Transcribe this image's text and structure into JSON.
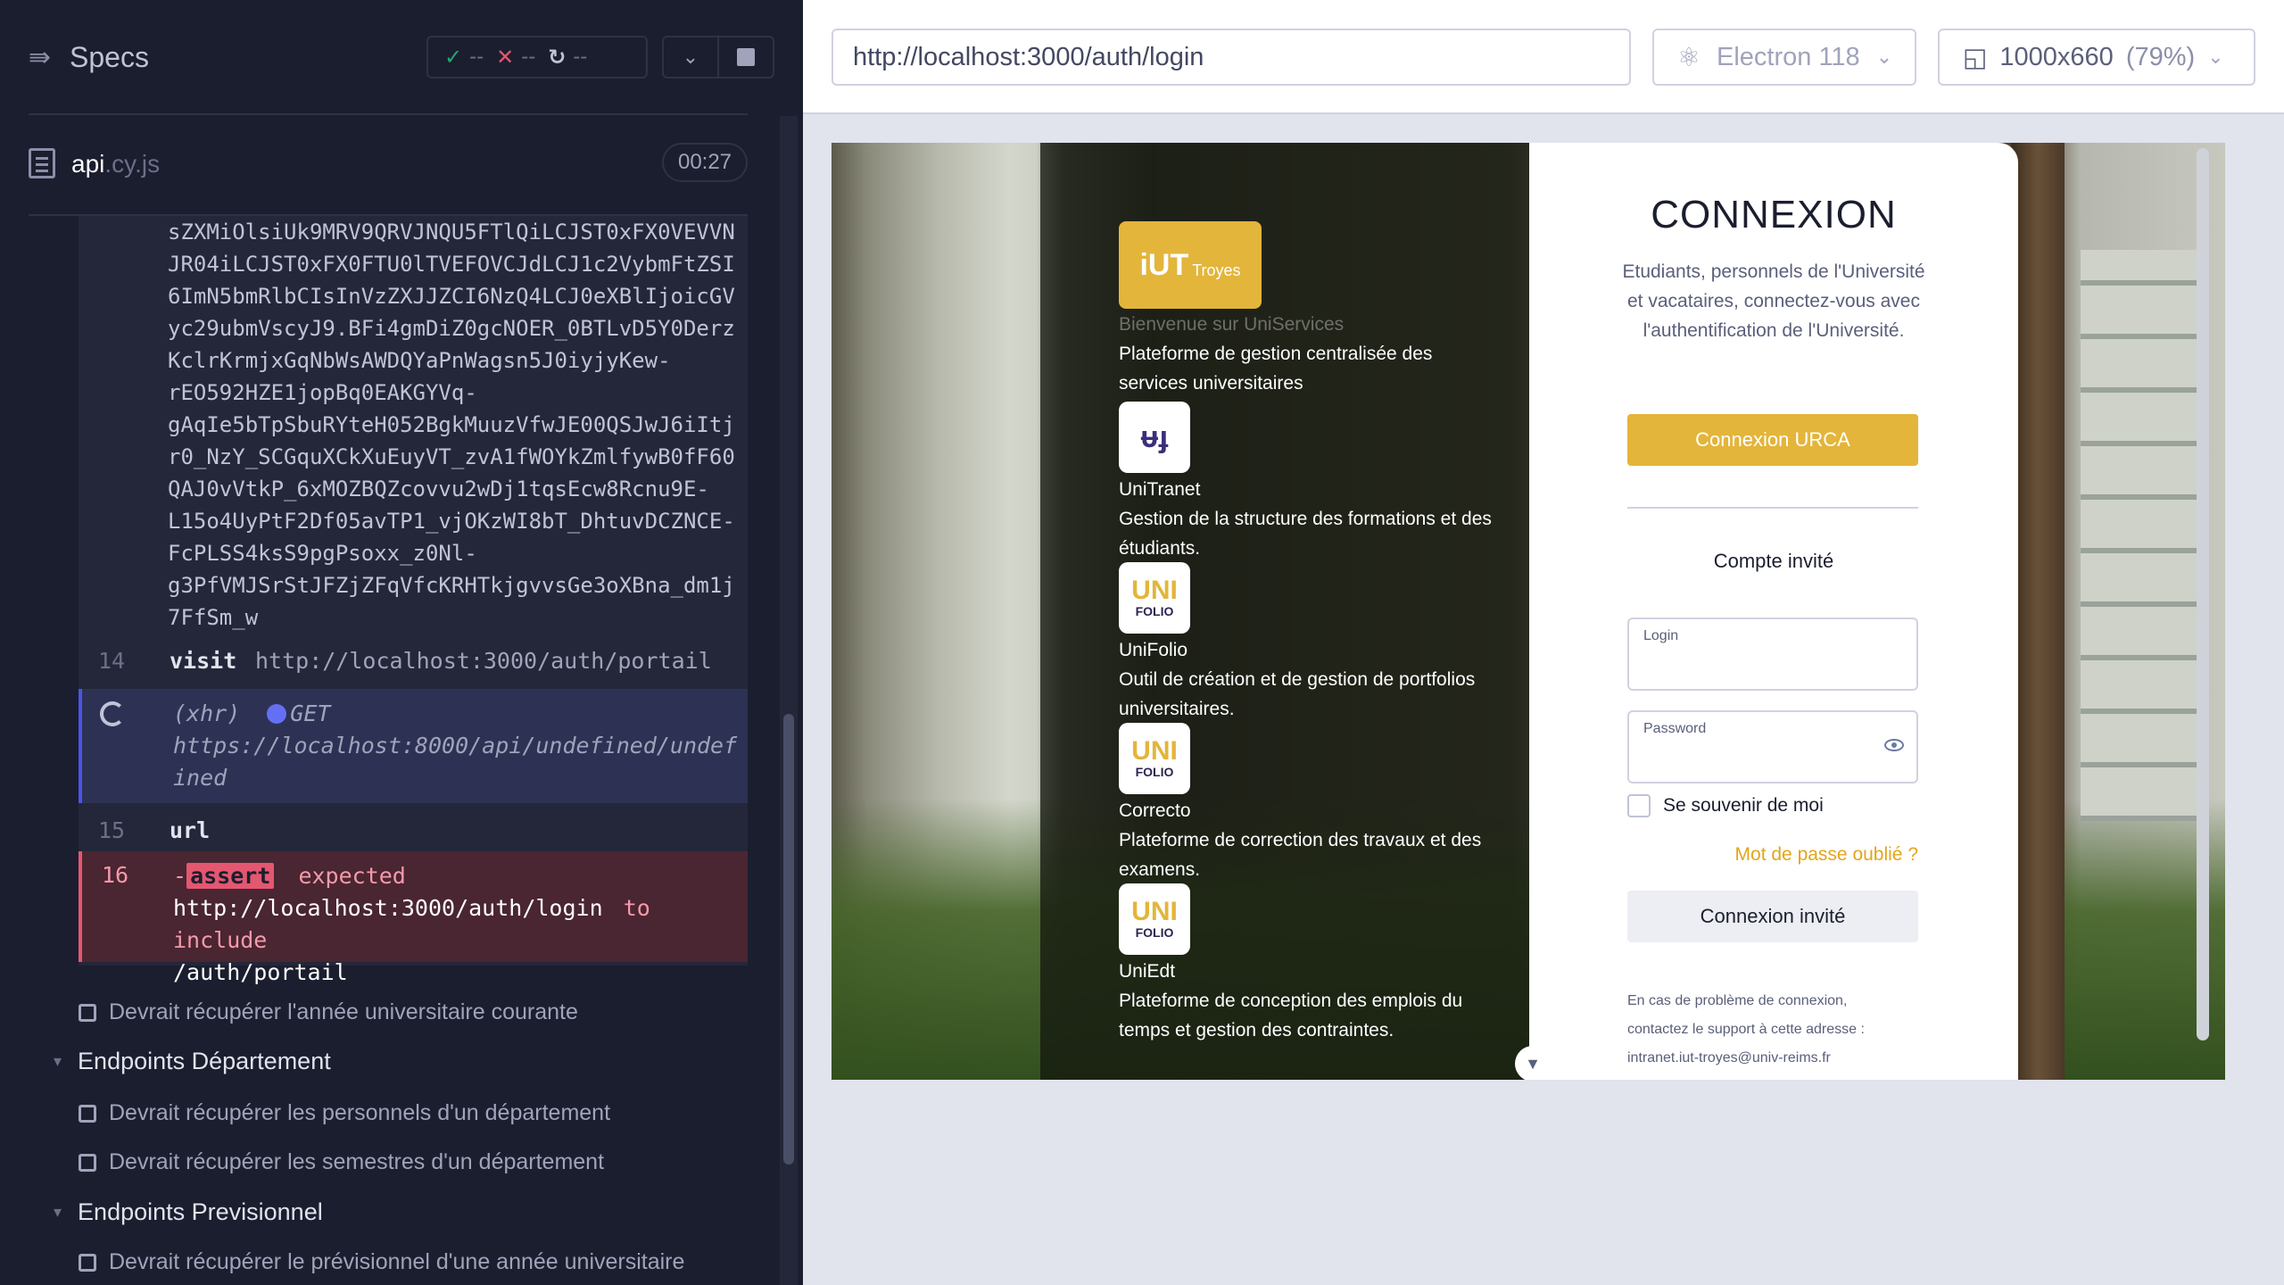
{
  "reporter": {
    "title": "Specs",
    "stats": {
      "passed": "--",
      "failed": "--",
      "pending": "--"
    },
    "file": {
      "name": "api",
      "ext": ".cy.js",
      "duration": "00:27"
    },
    "token_lines": [
      "sZXMiOlsiUk9MRV9QRVJNQU5FTlQiLCJST0xFX0VEVVN",
      "JR04iLCJST0xFX0FTU0lTVEFOVCJdLCJ1c2VybmFtZSI",
      "6ImN5bmRlbCIsInVzZXJJZCI6NzQ4LCJ0eXBlIjoicGV",
      "yc29ubmVscyJ9.BFi4gmDiZ0gcNOER_0BTLvD5Y0Derz",
      "KclrKrmjxGqNbWsAWDQYaPnWagsn5J0iyjyKew-",
      "rEO592HZE1jopBq0EAKGYVq-",
      "gAqIe5bTpSbuRYteH052BgkMuuzVfwJE00QSJwJ6iItj",
      "r0_NzY_SCGquXCkXuEuyVT_zvA1fWOYkZmlfywB0fF60",
      "QAJ0vVtkP_6xMOZBQZcovvu2wDj1tqsEcw8Rcnu9E-",
      "L15o4UyPtF2Df05avTP1_vjOKzWI8bT_DhtuvDCZNCE-",
      "FcPLSS4ksS9pgPsoxx_z0Nl-",
      "g3PfVMJSrStJFZjZFqVfcKRHTkjgvvsGe3oXBna_dm1j",
      "7FfSm_w"
    ],
    "commands": {
      "visit": {
        "num": "14",
        "name": "visit",
        "msg": "http://localhost:3000/auth/portail"
      },
      "xhr": {
        "label": "(xhr)",
        "method": "GET",
        "url": "https://localhost:8000/api/undefined/undefined"
      },
      "url": {
        "num": "15",
        "name": "url"
      },
      "assert": {
        "num": "16",
        "prefix": "-",
        "name": "assert",
        "expected": "expected",
        "actual": "http://localhost:3000/auth/login",
        "op": "to include",
        "value": "/auth/portail"
      }
    },
    "tests": [
      "Devrait récupérer l'année universitaire courante",
      "Devrait récupérer les personnels d'un département",
      "Devrait récupérer les semestres d'un département",
      "Devrait récupérer le prévisionnel d'une année universitaire"
    ],
    "suites": [
      "Endpoints Département",
      "Endpoints Previsionnel"
    ]
  },
  "aut": {
    "url": "http://localhost:3000/auth/login",
    "browser": "Electron 118",
    "viewport": "1000x660",
    "scale": "(79%)"
  },
  "page": {
    "brand": {
      "logo_main": "iUT",
      "logo_sub": "Troyes",
      "tagline": "Bienvenue sur UniServices"
    },
    "apps": [
      {
        "name": "",
        "desc": "Plateforme de gestion centralisée des services universitaires"
      },
      {
        "name": "UniTranet",
        "desc": "Gestion de la structure des formations et des étudiants."
      },
      {
        "name": "UniFolio",
        "desc": "Outil de création et de gestion de portfolios universitaires."
      },
      {
        "name": "Correcto",
        "desc": "Plateforme de correction des travaux et des examens."
      },
      {
        "name": "UniEdt",
        "desc": "Plateforme de conception des emplois du temps et gestion des contraintes."
      }
    ],
    "login": {
      "title": "CONNEXION",
      "intro": "Etudiants, personnels de l'Université et vacataires, connectez-vous avec l'authentification de l'Université.",
      "urca_button": "Connexion URCA",
      "guest_title": "Compte invité",
      "login_label": "Login",
      "password_label": "Password",
      "remember": "Se souvenir de moi",
      "forgot": "Mot de passe oublié ?",
      "guest_button": "Connexion invité",
      "support_line1": "En cas de problème de connexion,",
      "support_line2": "contactez le support à cette adresse :",
      "support_email": "intranet.iut-troyes@univ-reims.fr"
    }
  },
  "colors": {
    "accent": "#e3b53a",
    "reporter_bg": "#1b1e2e",
    "fail": "#e45770",
    "pass": "#1fa971"
  }
}
